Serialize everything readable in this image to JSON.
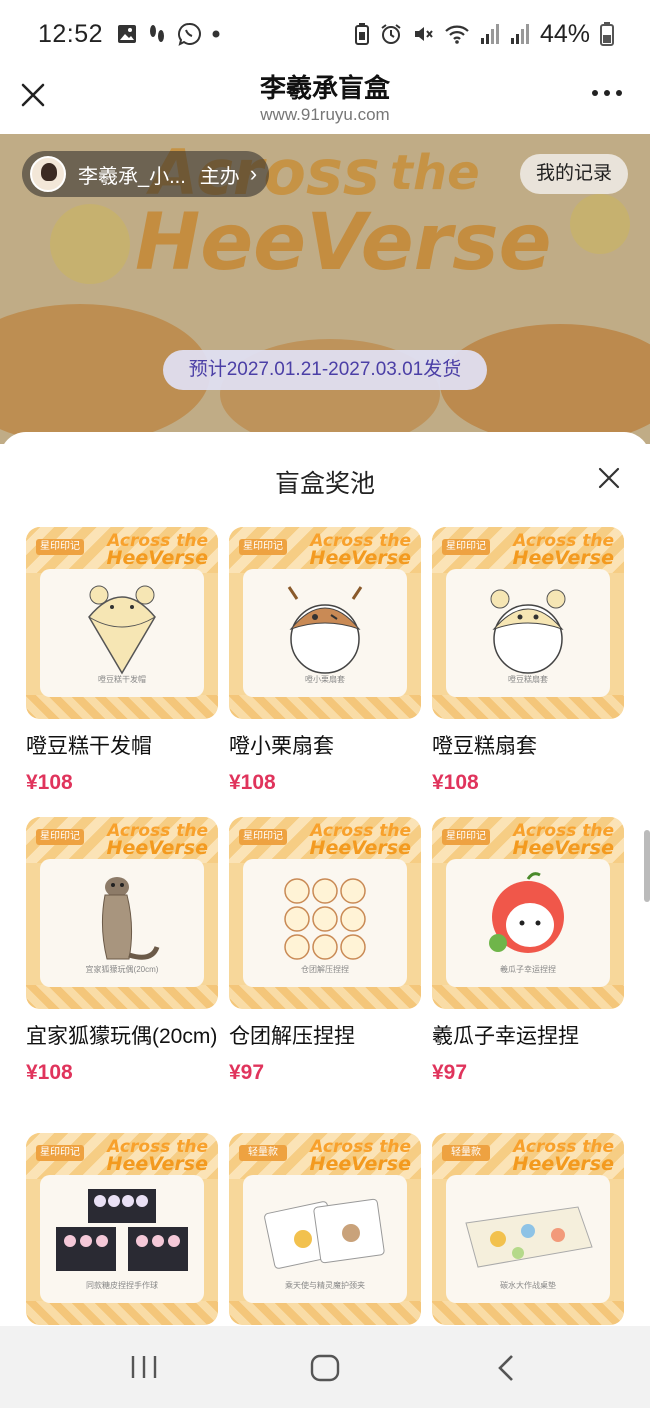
{
  "status_bar": {
    "time": "12:52",
    "battery": "44%",
    "left_icons": [
      "image-icon",
      "steps-icon",
      "viber-icon",
      "dot-icon"
    ],
    "right_icons": [
      "battery-saver-icon",
      "alarm-icon",
      "mute-icon",
      "wifi-icon",
      "signal-icon",
      "signal-icon",
      "battery-icon"
    ]
  },
  "app_header": {
    "title": "李羲承盲盒",
    "url": "www.91ruyu.com"
  },
  "banner": {
    "host_name": "李羲承_小...",
    "host_role": "主办",
    "host_chevron": "›",
    "my_records": "我的记录",
    "ship_date": "预计2027.01.21-2027.03.01发货"
  },
  "sheet": {
    "title": "盲盒奖池",
    "items": [
      {
        "name": "噔豆糕干发帽",
        "price": "¥108",
        "caption": "噔豆糕干发帽",
        "badge": "星印印记"
      },
      {
        "name": "噔小栗扇套",
        "price": "¥108",
        "caption": "噔小栗扇套",
        "badge": "星印印记"
      },
      {
        "name": "噔豆糕扇套",
        "price": "¥108",
        "caption": "噔豆糕扇套",
        "badge": "星印印记"
      },
      {
        "name": "宜家狐獴玩偶(20cm)",
        "price": "¥108",
        "caption": "宜家狐獴玩偶(20cm)",
        "badge": "星印印记"
      },
      {
        "name": "仓团解压捏捏",
        "price": "¥97",
        "caption": "仓团解压捏捏",
        "badge": "星印印记"
      },
      {
        "name": "羲瓜子幸运捏捏",
        "price": "¥97",
        "caption": "羲瓜子幸运捏捏",
        "badge": "星印印记"
      },
      {
        "name": "",
        "price": "",
        "caption": "同款糖皮捏捏手作球",
        "badge": "星印印记"
      },
      {
        "name": "",
        "price": "",
        "caption": "乘天使与精灵魔护颈夹",
        "badge": "轻量款"
      },
      {
        "name": "",
        "price": "",
        "caption": "碳水大作战桌垫",
        "badge": "轻量款"
      }
    ]
  },
  "logo_text": {
    "line1": "Across the",
    "line2": "HeeVerse"
  },
  "colors": {
    "price": "#e0345c",
    "accent": "#f8a12c",
    "ship_text": "#4b3fa6"
  }
}
